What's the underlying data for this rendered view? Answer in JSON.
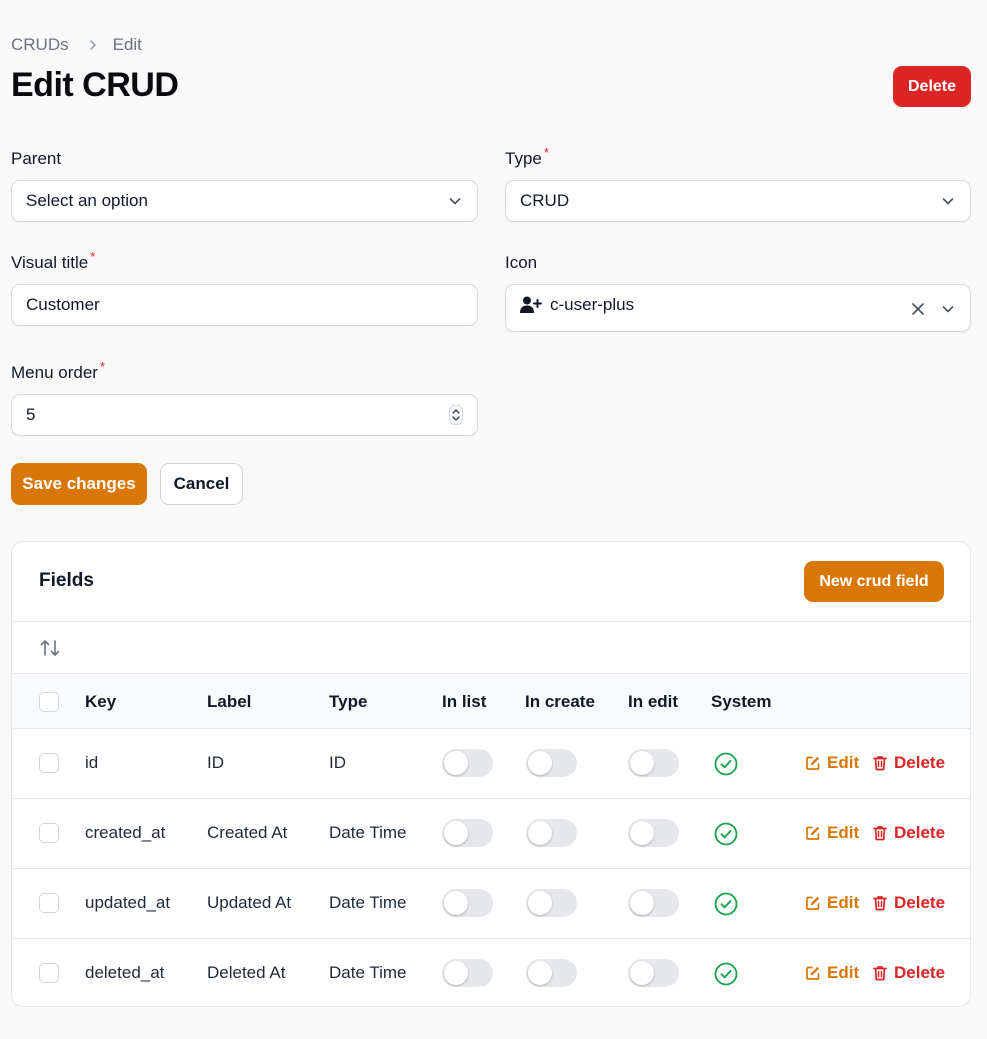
{
  "breadcrumb": {
    "root": "CRUDs",
    "current": "Edit"
  },
  "header": {
    "title": "Edit CRUD",
    "delete_label": "Delete"
  },
  "form": {
    "parent": {
      "label": "Parent",
      "value": "Select an option"
    },
    "type": {
      "label": "Type",
      "value": "CRUD",
      "required_mark": "*"
    },
    "visual_title": {
      "label": "Visual title",
      "value": "Customer",
      "required_mark": "*"
    },
    "icon": {
      "label": "Icon",
      "value": "c-user-plus",
      "icon_name": "user-plus-icon"
    },
    "menu_order": {
      "label": "Menu order",
      "value": "5",
      "required_mark": "*"
    },
    "save_label": "Save changes",
    "cancel_label": "Cancel"
  },
  "fields": {
    "title": "Fields",
    "new_label": "New crud field",
    "columns": [
      "Key",
      "Label",
      "Type",
      "In list",
      "In create",
      "In edit",
      "System"
    ],
    "rows": [
      {
        "key": "id",
        "label": "ID",
        "type": "ID",
        "in_list": false,
        "in_create": false,
        "in_edit": false,
        "system": true
      },
      {
        "key": "created_at",
        "label": "Created At",
        "type": "Date Time",
        "in_list": false,
        "in_create": false,
        "in_edit": false,
        "system": true
      },
      {
        "key": "updated_at",
        "label": "Updated At",
        "type": "Date Time",
        "in_list": false,
        "in_create": false,
        "in_edit": false,
        "system": true
      },
      {
        "key": "deleted_at",
        "label": "Deleted At",
        "type": "Date Time",
        "in_list": false,
        "in_create": false,
        "in_edit": false,
        "system": true
      }
    ],
    "edit_label": "Edit",
    "delete_label": "Delete"
  },
  "colors": {
    "primary": "#d97706",
    "danger": "#dc2626",
    "success": "#16a34a"
  }
}
